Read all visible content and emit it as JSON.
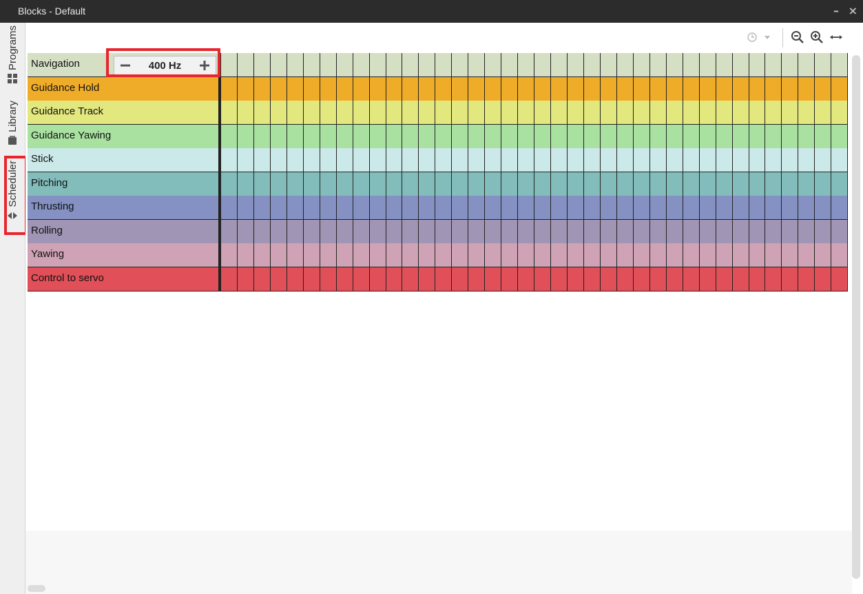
{
  "window": {
    "title": "Blocks - Default",
    "minimize": "–",
    "close": "×"
  },
  "side_tabs": [
    {
      "label": "Programs",
      "icon": "program-icon"
    },
    {
      "label": "Library",
      "icon": "library-icon"
    },
    {
      "label": "Scheduler",
      "icon": "scheduler-icon"
    }
  ],
  "toolbar": {
    "buttons": [
      "clock-icon",
      "dropdown-icon",
      "zoom-out-icon",
      "zoom-in-icon",
      "fit-width-icon"
    ]
  },
  "frequency": {
    "value": "400 Hz",
    "decrement": "−",
    "increment": "+"
  },
  "rows": [
    {
      "name": "Navigation",
      "color": "#d4dfc4"
    },
    {
      "name": "Guidance Hold",
      "color": "#efac29"
    },
    {
      "name": "Guidance Track",
      "color": "#e2e77e"
    },
    {
      "name": "Guidance Yawing",
      "color": "#a8e1a0"
    },
    {
      "name": "Stick",
      "color": "#cbe9e9"
    },
    {
      "name": "Pitching",
      "color": "#82bdbb"
    },
    {
      "name": "Thrusting",
      "color": "#8491c2"
    },
    {
      "name": "Rolling",
      "color": "#a095b4"
    },
    {
      "name": "Yawing",
      "color": "#d0a2b5"
    },
    {
      "name": "Control to servo",
      "color": "#e14f58"
    }
  ],
  "grid_columns": 38
}
